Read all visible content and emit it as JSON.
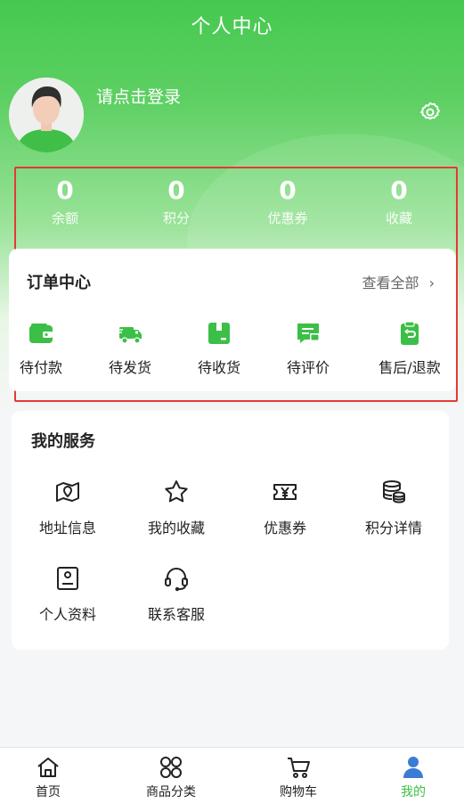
{
  "header": {
    "title": "个人中心"
  },
  "profile": {
    "login_prompt": "请点击登录"
  },
  "stats": [
    {
      "value": "0",
      "label": "余额"
    },
    {
      "value": "0",
      "label": "积分"
    },
    {
      "value": "0",
      "label": "优惠券"
    },
    {
      "value": "0",
      "label": "收藏"
    }
  ],
  "orders": {
    "title": "订单中心",
    "view_all": "查看全部",
    "items": [
      {
        "label": "待付款",
        "icon": "wallet-icon"
      },
      {
        "label": "待发货",
        "icon": "truck-icon"
      },
      {
        "label": "待收货",
        "icon": "package-icon"
      },
      {
        "label": "待评价",
        "icon": "review-icon"
      },
      {
        "label": "售后/退款",
        "icon": "refund-icon"
      }
    ]
  },
  "services": {
    "title": "我的服务",
    "items": [
      {
        "label": "地址信息",
        "icon": "map-icon"
      },
      {
        "label": "我的收藏",
        "icon": "star-icon"
      },
      {
        "label": "优惠券",
        "icon": "coupon-icon"
      },
      {
        "label": "积分详情",
        "icon": "coins-icon"
      },
      {
        "label": "个人资料",
        "icon": "profile-card-icon"
      },
      {
        "label": "联系客服",
        "icon": "headset-icon"
      }
    ]
  },
  "tabbar": {
    "items": [
      {
        "label": "首页",
        "icon": "home-icon",
        "active": false
      },
      {
        "label": "商品分类",
        "icon": "category-icon",
        "active": false
      },
      {
        "label": "购物车",
        "icon": "cart-icon",
        "active": false
      },
      {
        "label": "我的",
        "icon": "user-icon",
        "active": true
      }
    ]
  },
  "colors": {
    "brand_green": "#45c94f",
    "active_tab": "#3cbf47",
    "highlight_border": "#e53935"
  }
}
